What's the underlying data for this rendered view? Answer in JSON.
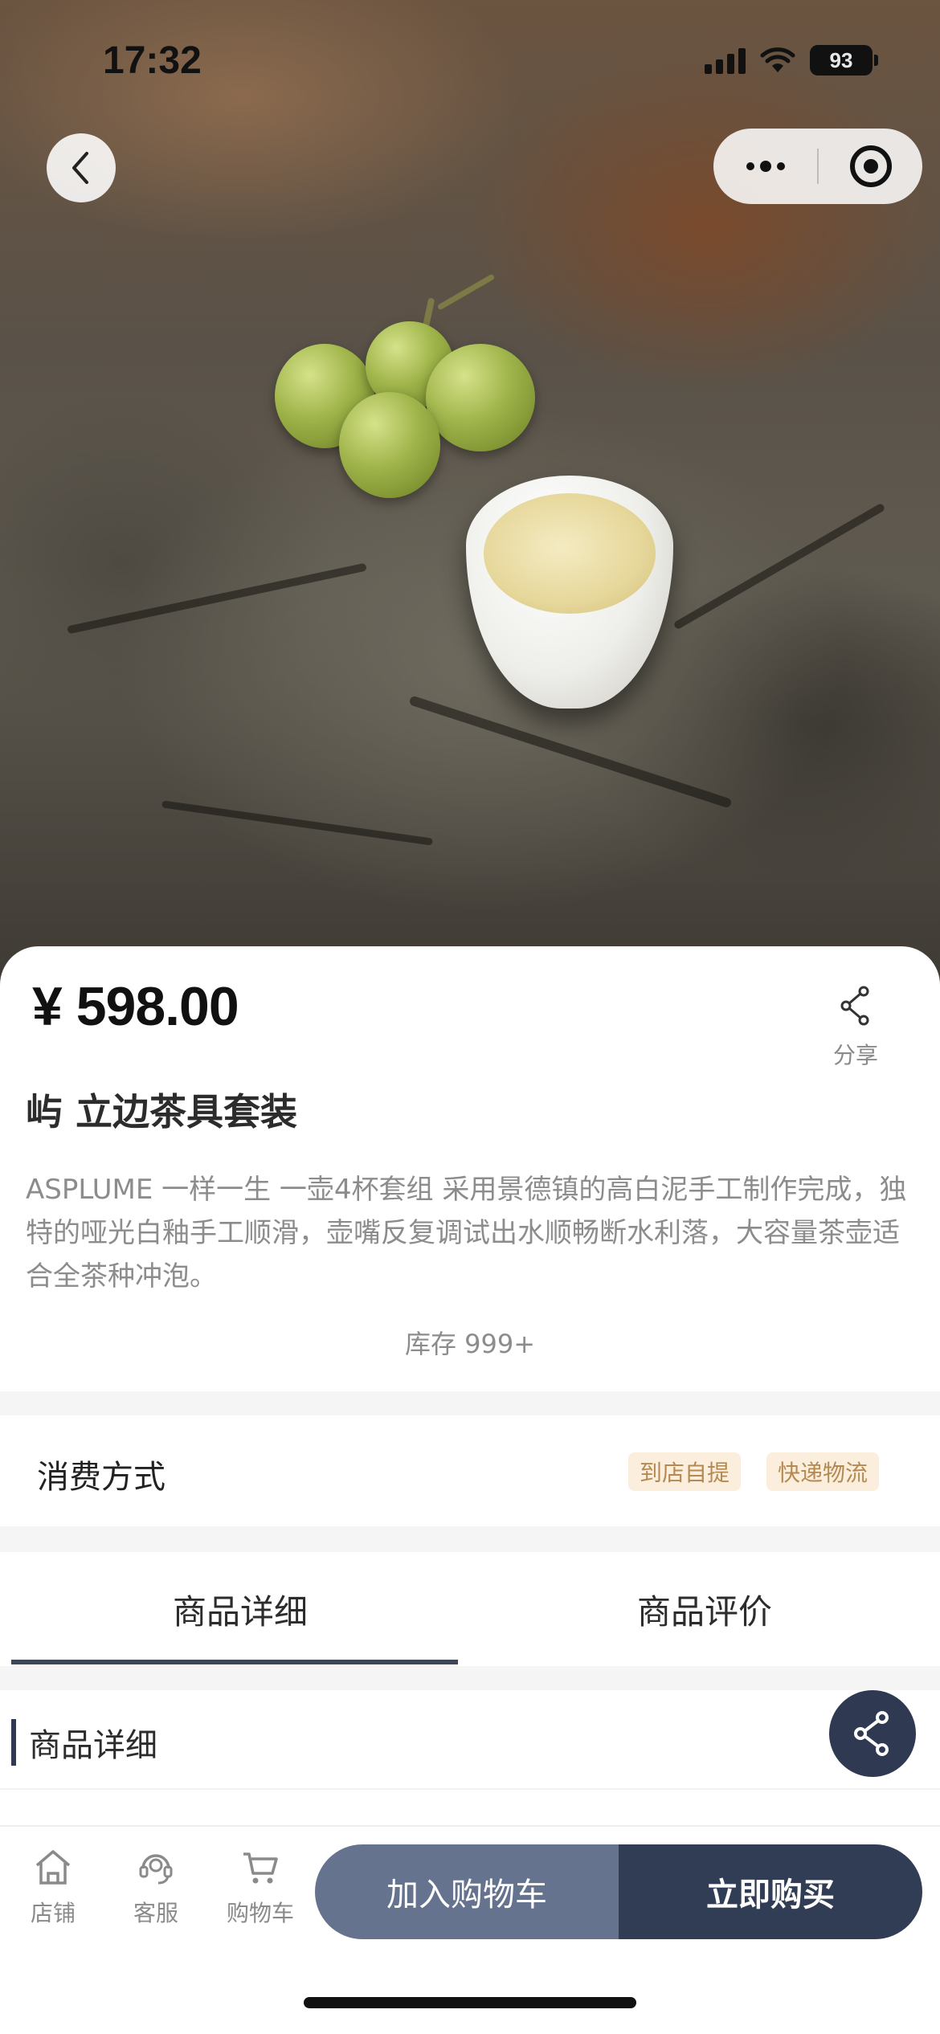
{
  "status_bar": {
    "time": "17:32",
    "battery": "93"
  },
  "product": {
    "price": "¥ 598.00",
    "share_label": "分享",
    "title": "屿 立边茶具套装",
    "description": "ASPLUME 一样一生 一壶4杯套组 采用景德镇的高白泥手工制作完成，独特的哑光白釉手工顺滑，壶嘴反复调试出水顺畅断水利落，大容量茶壶适合全茶种冲泡。",
    "stock": "库存 999+"
  },
  "consumption": {
    "label": "消费方式",
    "tags": [
      "到店自提",
      "快递物流"
    ]
  },
  "tabs": [
    {
      "label": "商品详细",
      "active": true
    },
    {
      "label": "商品评价",
      "active": false
    }
  ],
  "section": {
    "title": "商品详细"
  },
  "bottom_bar": {
    "nav": [
      {
        "label": "店铺",
        "icon": "store-icon"
      },
      {
        "label": "客服",
        "icon": "customer-service-icon"
      },
      {
        "label": "购物车",
        "icon": "cart-icon"
      }
    ],
    "add_to_cart": "加入购物车",
    "buy_now": "立即购买"
  },
  "colors": {
    "primary_dark": "#313d55",
    "primary_light": "#66738e",
    "tag_bg": "#fbeedd",
    "tag_text": "#b58a52"
  }
}
